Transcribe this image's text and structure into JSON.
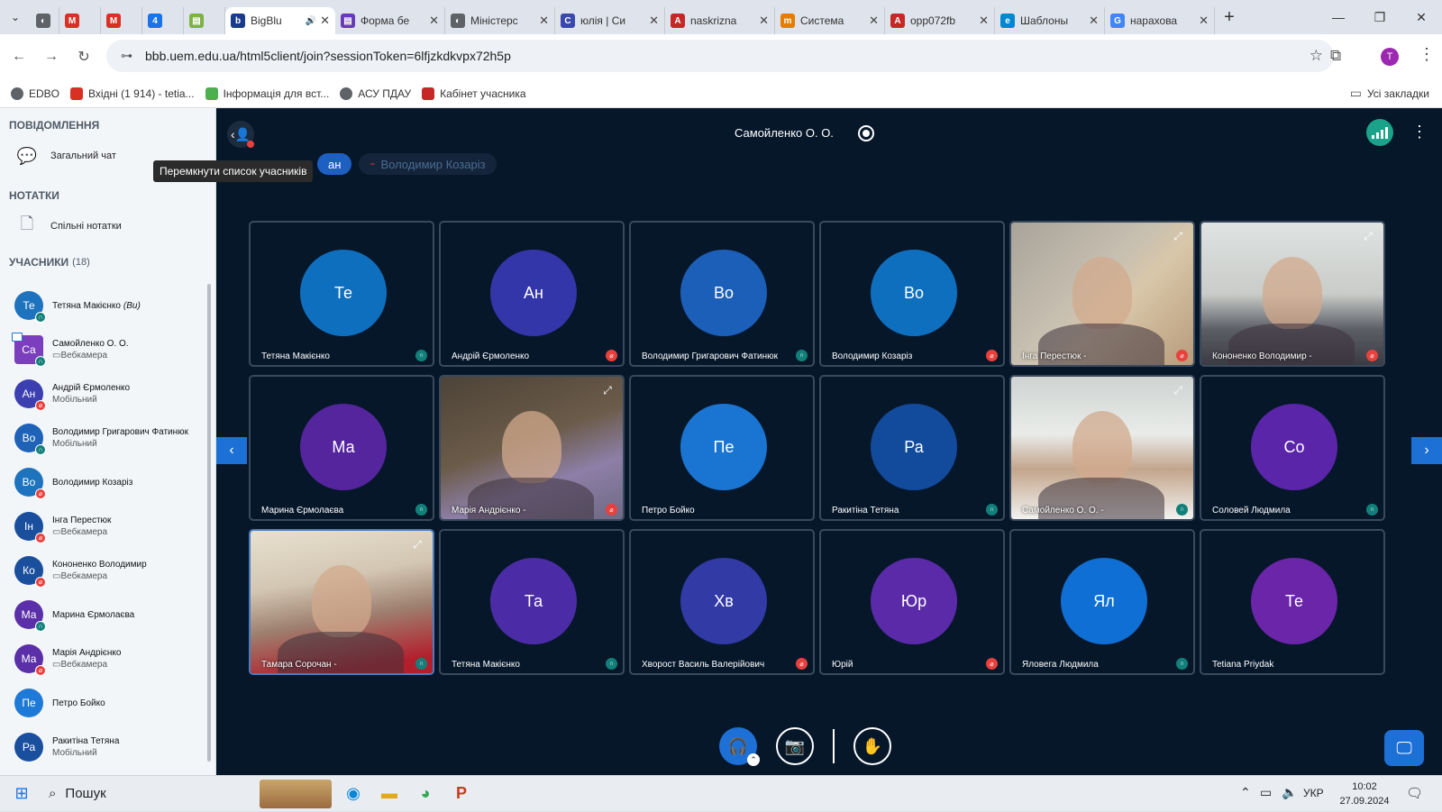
{
  "browser": {
    "tabs": [
      {
        "title": "",
        "color": "#5f6368",
        "glyph": "◐"
      },
      {
        "title": "",
        "color": "#d93025",
        "glyph": "M"
      },
      {
        "title": "",
        "color": "#d93025",
        "glyph": "M"
      },
      {
        "title": "",
        "color": "#1a73e8",
        "glyph": "4"
      },
      {
        "title": "",
        "color": "#7cb342",
        "glyph": "▤"
      },
      {
        "title": "BigBlu",
        "color": "#1a3a8a",
        "glyph": "b",
        "active": true
      },
      {
        "title": "Форма бе",
        "color": "#673ab7",
        "glyph": "▤"
      },
      {
        "title": "Міністерс",
        "color": "#5f6368",
        "glyph": "◐"
      },
      {
        "title": "юлія | Си",
        "color": "#3949ab",
        "glyph": "C"
      },
      {
        "title": "naskrizna",
        "color": "#c62828",
        "glyph": "A"
      },
      {
        "title": "Система",
        "color": "#e67c00",
        "glyph": "m"
      },
      {
        "title": "opp072fb",
        "color": "#c62828",
        "glyph": "A"
      },
      {
        "title": "Шаблоны",
        "color": "#0288d1",
        "glyph": "e"
      },
      {
        "title": "нарахова",
        "color": "#4285f4",
        "glyph": "G"
      }
    ],
    "url": "bbb.uem.edu.ua/html5client/join?sessionToken=6lfjzkdkvpx72h5p",
    "bookmarks": [
      "EDBO",
      "Вхідні (1 914) - tetia...",
      "Інформація для вст...",
      "АСУ ПДАУ",
      "Кабінет учасника"
    ],
    "all_bookmarks": "Усі закладки",
    "profile_initial": "T"
  },
  "sidebar": {
    "messages_title": "ПОВІДОМЛЕННЯ",
    "public_chat": "Загальний чат",
    "notes_title": "НОТАТКИ",
    "shared_notes": "Спільні нотатки",
    "users_title": "УЧАСНИКИ",
    "users_count": "(18)",
    "users": [
      {
        "initials": "Те",
        "name": "Тетяна Макієнко",
        "you": "(Ви)",
        "sub": "",
        "color": "#1e73be",
        "badge": "listen"
      },
      {
        "initials": "Са",
        "name": "Самойленко О. О.",
        "sub": "▭Вебкамера",
        "color": "#7b3fbd",
        "badge": "listen",
        "presenter": true
      },
      {
        "initials": "Ан",
        "name": "Андрій Єрмоленко",
        "sub": "Мобільний",
        "color": "#3b3fb0",
        "badge": "muted"
      },
      {
        "initials": "Во",
        "name": "Володимир Григарович Фатинюк",
        "sub": "Мобільний",
        "color": "#1e63b8",
        "badge": "listen"
      },
      {
        "initials": "Во",
        "name": "Володимир Козаріз",
        "sub": "",
        "color": "#1e73be",
        "badge": "muted"
      },
      {
        "initials": "Ін",
        "name": "Інга Перестюк",
        "sub": "▭Вебкамера",
        "color": "#1a4f9e",
        "badge": "muted"
      },
      {
        "initials": "Ко",
        "name": "Кононенко Володимир",
        "sub": "▭Вебкамера",
        "color": "#1a4f9e",
        "badge": "muted"
      },
      {
        "initials": "Ма",
        "name": "Марина Єрмолаєва",
        "sub": "",
        "color": "#5b2fa8",
        "badge": "listen"
      },
      {
        "initials": "Ма",
        "name": "Марія Андрієнко",
        "sub": "▭Вебкамера",
        "color": "#5b2fa8",
        "badge": "muted"
      },
      {
        "initials": "Пе",
        "name": "Петро Бойко",
        "sub": "",
        "color": "#1e7ad6",
        "badge": "none"
      },
      {
        "initials": "Ра",
        "name": "Ракитіна Тетяна",
        "sub": "Мобільний",
        "color": "#1a4f9e",
        "badge": "none"
      }
    ],
    "tooltip": "Перемкнути список учасників"
  },
  "meeting": {
    "presenter_title": "Самойленко О. О.",
    "talking": [
      {
        "name": "ан",
        "active": true
      },
      {
        "name": "Володимир Козаріз",
        "active": false
      }
    ],
    "tiles": [
      {
        "label": "Тетяна Макієнко",
        "initials": "Те",
        "color": "#0f6fbf",
        "icon": "listen"
      },
      {
        "label": "Андрій Єрмоленко",
        "initials": "Ан",
        "color": "#3336a8",
        "icon": "muted"
      },
      {
        "label": "Володимир Григарович Фатинюк",
        "initials": "Во",
        "color": "#1b5fb8",
        "icon": "listen"
      },
      {
        "label": "Володимир Козаріз",
        "initials": "Во",
        "color": "#0f6fbf",
        "icon": "muted"
      },
      {
        "label": "Інга Перестюк  -",
        "video": "inga",
        "icon": "muted"
      },
      {
        "label": "Кононенко Володимир  -",
        "video": "kononenko",
        "icon": "muted"
      },
      {
        "label": "Марина Єрмолаєва",
        "initials": "Ма",
        "color": "#55259e",
        "icon": "listen"
      },
      {
        "label": "Марія Андрієнко  -",
        "video": "mariia",
        "icon": "muted"
      },
      {
        "label": "Петро Бойко",
        "initials": "Пе",
        "color": "#1a75d2",
        "icon": "none"
      },
      {
        "label": "Ракитіна Тетяна",
        "initials": "Ра",
        "color": "#124a9c",
        "icon": "listen"
      },
      {
        "label": "Самойленко О. О.  -",
        "video": "samoilenko",
        "icon": "listen"
      },
      {
        "label": "Соловей Людмила",
        "initials": "Со",
        "color": "#5a25a8",
        "icon": "listen"
      },
      {
        "label": "Тамара Сорочан  -",
        "video": "tamara",
        "icon": "listen",
        "highlight": true
      },
      {
        "label": "Тетяна Макієнко",
        "initials": "Та",
        "color": "#4c2ca6",
        "icon": "listen"
      },
      {
        "label": "Хворост Василь Валерійович",
        "initials": "Хв",
        "color": "#323aa6",
        "icon": "muted"
      },
      {
        "label": "Юрій",
        "initials": "Юр",
        "color": "#5a2aa8",
        "icon": "muted"
      },
      {
        "label": "Яловега Людмила",
        "initials": "Ял",
        "color": "#0f6fd4",
        "icon": "listen"
      },
      {
        "label": "Tetiana Priydak",
        "initials": "Те",
        "color": "#6a25a8",
        "icon": "none"
      }
    ]
  },
  "taskbar": {
    "search": "Пошук",
    "lang": "УКР",
    "time": "10:02",
    "date": "27.09.2024"
  },
  "colors": {
    "muted": "#e8413d",
    "listen": "#12807a",
    "accent": "#1d70d6"
  }
}
